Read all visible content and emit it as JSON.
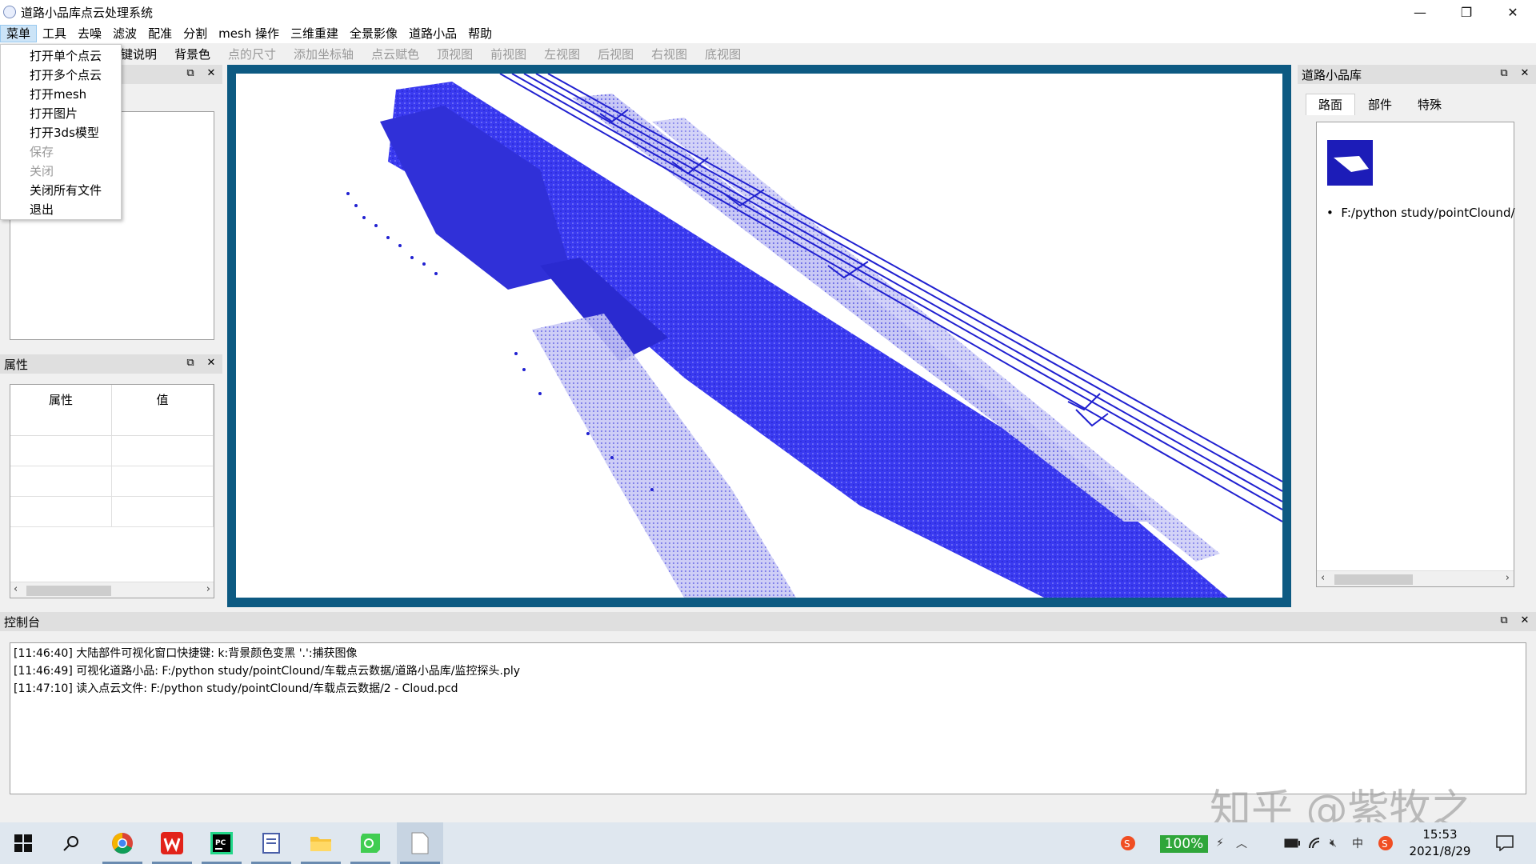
{
  "window": {
    "title": "道路小品库点云处理系统",
    "minimize": "—",
    "restore": "❐",
    "close": "✕"
  },
  "menubar": [
    "菜单",
    "工具",
    "去噪",
    "滤波",
    "配准",
    "分割",
    "mesh 操作",
    "三维重建",
    "全景影像",
    "道路小品",
    "帮助"
  ],
  "toolbar": {
    "items": [
      {
        "label": "键说明",
        "enabled": true
      },
      {
        "label": "背景色",
        "enabled": true
      },
      {
        "label": "点的尺寸",
        "enabled": false
      },
      {
        "label": "添加坐标轴",
        "enabled": false
      },
      {
        "label": "点云赋色",
        "enabled": false
      },
      {
        "label": "顶视图",
        "enabled": false
      },
      {
        "label": "前视图",
        "enabled": false
      },
      {
        "label": "左视图",
        "enabled": false
      },
      {
        "label": "后视图",
        "enabled": false
      },
      {
        "label": "右视图",
        "enabled": false
      },
      {
        "label": "底视图",
        "enabled": false
      }
    ]
  },
  "dropdown": {
    "items": [
      {
        "label": "打开单个点云",
        "disabled": false
      },
      {
        "label": "打开多个点云",
        "disabled": false
      },
      {
        "label": "打开mesh",
        "disabled": false
      },
      {
        "label": "打开图片",
        "disabled": false
      },
      {
        "label": "打开3ds模型",
        "disabled": false
      },
      {
        "label": "保存",
        "disabled": true
      },
      {
        "label": "关闭",
        "disabled": true
      },
      {
        "label": "关闭所有文件",
        "disabled": false
      },
      {
        "label": "退出",
        "disabled": false
      }
    ]
  },
  "properties": {
    "title": "属性",
    "col_attr": "属性",
    "col_value": "值"
  },
  "library": {
    "title": "道路小品库",
    "tabs": [
      "路面",
      "部件",
      "特殊"
    ],
    "item_path": "F:/python study/pointClound/"
  },
  "console": {
    "title": "控制台",
    "lines": [
      "[11:46:40] 大陆部件可视化窗口快捷键: k:背景颜色变黑 '.':捕获图像",
      "[11:46:49] 可视化道路小品:  F:/python study/pointClound/车载点云数据/道路小品库/监控探头.ply",
      "[11:47:10] 读入点云文件:  F:/python study/pointClound/车载点云数据/2 - Cloud.pcd"
    ]
  },
  "watermark": "知乎 @紫牧之",
  "taskbar": {
    "battery": "100%",
    "time": "15:53",
    "date": "2021/8/29",
    "ime": "中"
  },
  "colors": {
    "point_cloud": "#2222dd",
    "viewer_frame": "#0d5a82",
    "battery_green": "#2fa63a"
  }
}
